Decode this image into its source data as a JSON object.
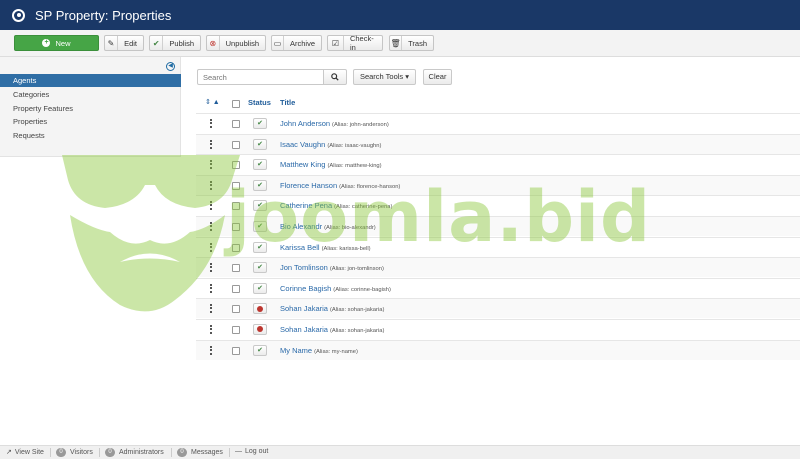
{
  "header": {
    "title": "SP Property: Properties"
  },
  "toolbar": {
    "new": "New",
    "edit": "Edit",
    "publish": "Publish",
    "unpublish": "Unpublish",
    "archive": "Archive",
    "checkin": "Check-in",
    "trash": "Trash"
  },
  "sidebar": {
    "items": [
      {
        "label": "Agents",
        "active": true
      },
      {
        "label": "Categories",
        "active": false
      },
      {
        "label": "Property Features",
        "active": false
      },
      {
        "label": "Properties",
        "active": false
      },
      {
        "label": "Requests",
        "active": false
      }
    ]
  },
  "filters": {
    "search_placeholder": "Search",
    "search_tools": "Search Tools ▾",
    "clear": "Clear"
  },
  "table": {
    "columns": {
      "status": "Status",
      "title": "Title"
    },
    "rows": [
      {
        "name": "John Anderson",
        "alias": "(Alias: john-anderson)",
        "published": true
      },
      {
        "name": "Isaac Vaughn",
        "alias": "(Alias: isaac-vaughn)",
        "published": true
      },
      {
        "name": "Matthew King",
        "alias": "(Alias: matthew-king)",
        "published": true
      },
      {
        "name": "Florence Hanson",
        "alias": "(Alias: florence-hanson)",
        "published": true
      },
      {
        "name": "Catherine Pena",
        "alias": "(Alias: catherine-pena)",
        "published": true
      },
      {
        "name": "Bio Alexandr",
        "alias": "(Alias: bio-alexandr)",
        "published": true
      },
      {
        "name": "Karissa Bell",
        "alias": "(Alias: karissa-bell)",
        "published": true
      },
      {
        "name": "Jon Tomlinson",
        "alias": "(Alias: jon-tomlinson)",
        "published": true
      },
      {
        "name": "Corinne Bagish",
        "alias": "(Alias: corinne-bagish)",
        "published": true
      },
      {
        "name": "Sohan Jakaria",
        "alias": "(Alias: sohan-jakaria)",
        "published": false
      },
      {
        "name": "Sohan Jakaria",
        "alias": "(Alias: sohan-jakaria)",
        "published": false
      },
      {
        "name": "My Name",
        "alias": "(Alias: my-name)",
        "published": true
      }
    ]
  },
  "watermark": {
    "text": "joomla.bid"
  },
  "footer": {
    "view_site": "View Site",
    "visitors_count": "0",
    "visitors": "Visitors",
    "admins_count": "0",
    "administrators": "Administrators",
    "messages_count": "0",
    "messages": "Messages",
    "logout": "Log out"
  },
  "colors": {
    "header_bg": "#1a3867",
    "active_item": "#2f6ea5",
    "new_button": "#46a546",
    "link": "#2a69a8",
    "published": "#468847",
    "unpublished": "#bd362f"
  }
}
